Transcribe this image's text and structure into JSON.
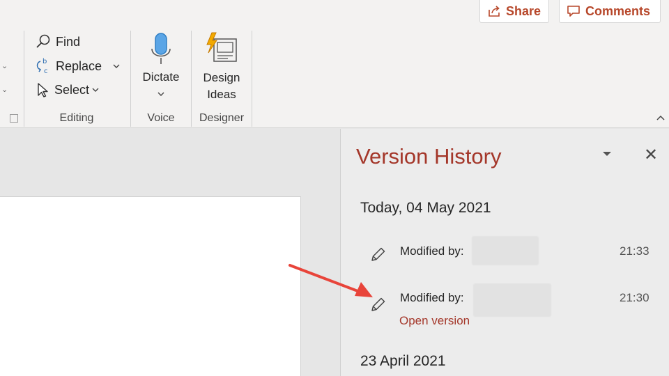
{
  "toolbar": {
    "share_label": "Share",
    "comments_label": "Comments"
  },
  "editing": {
    "find_label": "Find",
    "replace_label": "Replace",
    "select_label": "Select",
    "group_label": "Editing"
  },
  "voice": {
    "dictate_label": "Dictate",
    "group_label": "Voice"
  },
  "designer": {
    "design_ideas_line1": "Design",
    "design_ideas_line2": "Ideas",
    "group_label": "Designer"
  },
  "version_history": {
    "title": "Version History",
    "groups": [
      {
        "date": "Today, 04 May 2021",
        "entries": [
          {
            "label": "Modified by:",
            "time": "21:33"
          },
          {
            "label": "Modified by:",
            "time": "21:30",
            "action": "Open version"
          }
        ]
      },
      {
        "date": "23 April 2021"
      }
    ]
  },
  "colors": {
    "accent": "#a4372a",
    "ribbon_bg": "#f3f2f1",
    "pane_bg": "#ececec",
    "annotation_arrow": "#e8443a"
  }
}
